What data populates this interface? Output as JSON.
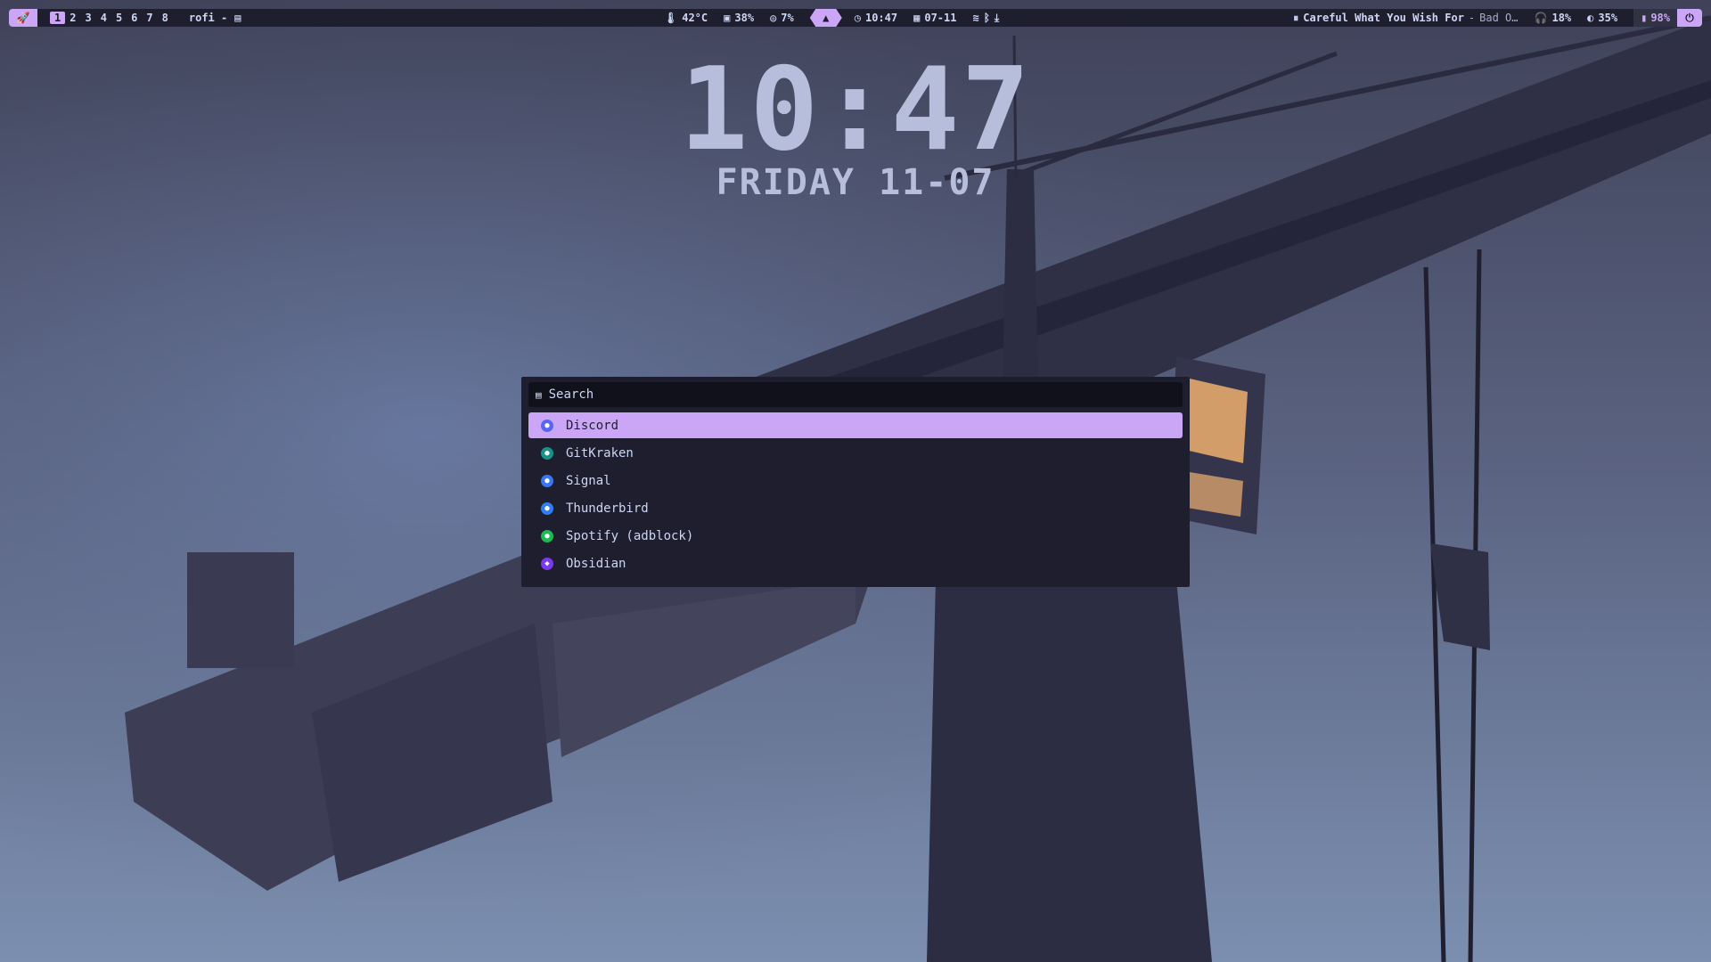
{
  "bar": {
    "launcher_icon": "rocket-icon",
    "workspaces": [
      "1",
      "2",
      "3",
      "4",
      "5",
      "6",
      "7",
      "8"
    ],
    "active_workspace": "1",
    "window_title": "rofi -",
    "temperature": "42°C",
    "cpu": "38%",
    "memory": "7%",
    "time": "10:47",
    "date": "07-11",
    "media_title": "Careful What You Wish For",
    "media_sep": "-",
    "media_artist": "Bad O…",
    "volume": "18%",
    "brightness": "35%",
    "battery": "98%"
  },
  "clock": {
    "time": "10:47",
    "date": "FRIDAY 11-07"
  },
  "rofi": {
    "search_placeholder": "Search",
    "entries": [
      {
        "label": "Discord",
        "color": "#5865f2",
        "selected": true
      },
      {
        "label": "GitKraken",
        "color": "#179287",
        "selected": false
      },
      {
        "label": "Signal",
        "color": "#3a76f0",
        "selected": false
      },
      {
        "label": "Thunderbird",
        "color": "#2f7ef0",
        "selected": false
      },
      {
        "label": "Spotify (adblock)",
        "color": "#1db954",
        "selected": false
      },
      {
        "label": "Obsidian",
        "color": "#7c3aed",
        "selected": false
      }
    ]
  },
  "colors": {
    "accent": "#cba6f7",
    "bar_bg": "#1e1e2e",
    "text": "#cdd6f4"
  }
}
